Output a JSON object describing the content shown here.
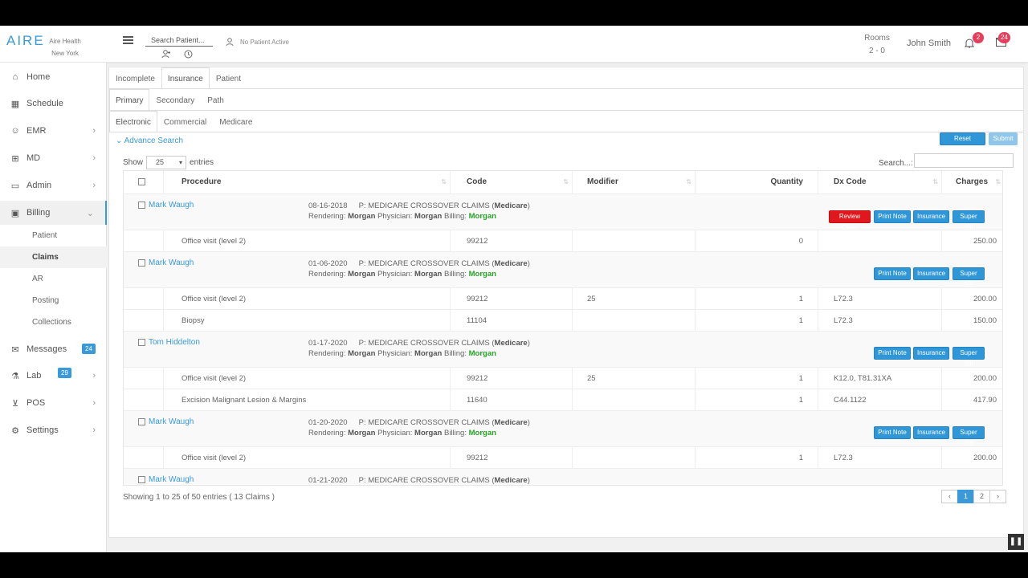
{
  "brand": {
    "logo": "AIRE",
    "org_line1": "Aire Health",
    "org_line2": "New York"
  },
  "topbar": {
    "search_placeholder": "Search Patient...",
    "patient_status": "No Patient Active",
    "rooms_label": "Rooms",
    "rooms_value": "2 - 0",
    "user": "John Smith",
    "notif_count": "2",
    "mail_count": "24"
  },
  "sidebar": {
    "items": [
      {
        "label": "Home",
        "icon": "home-icon"
      },
      {
        "label": "Schedule",
        "icon": "calendar-icon"
      },
      {
        "label": "EMR",
        "icon": "user-icon"
      },
      {
        "label": "MD",
        "icon": "medkit-icon"
      },
      {
        "label": "Admin",
        "icon": "monitor-icon"
      },
      {
        "label": "Billing",
        "icon": "money-icon"
      },
      {
        "label": "Messages",
        "icon": "envelope-icon",
        "badge": "24"
      },
      {
        "label": "Lab",
        "icon": "lab-icon",
        "badge": "29"
      },
      {
        "label": "POS",
        "icon": "cart-icon"
      },
      {
        "label": "Settings",
        "icon": "gears-icon"
      }
    ],
    "billing_sub": [
      "Patient",
      "Claims",
      "AR",
      "Posting",
      "Collections"
    ]
  },
  "tabs1": [
    "Incomplete",
    "Insurance",
    "Patient"
  ],
  "tabs2": [
    "Primary",
    "Secondary",
    "Path"
  ],
  "tabs3": [
    "Electronic",
    "Commercial",
    "Medicare"
  ],
  "toolbar": {
    "advance_search": "Advance Search",
    "reset": "Reset Search",
    "submit": "Submit",
    "show": "Show",
    "entries_value": "25",
    "entries": "entries",
    "search_label": "Search...:"
  },
  "columns": [
    "Procedure",
    "Code",
    "Modifier",
    "Quantity",
    "Dx Code",
    "Charges"
  ],
  "labels": {
    "rendering": "Rendering:",
    "physician": "Physician:",
    "billing": "Billing:"
  },
  "buttons": {
    "review": "Review Claim",
    "print": "Print Note",
    "insurance": "Insurance",
    "superbill": "Super Bill"
  },
  "groups": [
    {
      "patient": "Mark Waugh",
      "date": "08-16-2018",
      "payer": "P: MEDICARE CROSSOVER CLAIMS (",
      "payer_bold": "Medicare",
      "rendering": "Morgan",
      "physician": "Morgan",
      "billing": "Morgan",
      "review": true,
      "lines": [
        {
          "procedure": "Office visit (level 2)",
          "code": "99212",
          "modifier": "",
          "qty": "0",
          "dx": "",
          "charge": "250.00"
        }
      ]
    },
    {
      "patient": "Mark Waugh",
      "date": "01-06-2020",
      "payer": "P: MEDICARE CROSSOVER CLAIMS (",
      "payer_bold": "Medicare",
      "rendering": "Morgan",
      "physician": "Morgan",
      "billing": "Morgan",
      "review": false,
      "lines": [
        {
          "procedure": "Office visit (level 2)",
          "code": "99212",
          "modifier": "25",
          "qty": "1",
          "dx": "L72.3",
          "charge": "200.00"
        },
        {
          "procedure": "Biopsy",
          "code": "11104",
          "modifier": "",
          "qty": "1",
          "dx": "L72.3",
          "charge": "150.00"
        }
      ]
    },
    {
      "patient": "Tom Hiddelton",
      "date": "01-17-2020",
      "payer": "P: MEDICARE CROSSOVER CLAIMS (",
      "payer_bold": "Medicare",
      "rendering": "Morgan",
      "physician": "Morgan",
      "billing": "Morgan",
      "review": false,
      "lines": [
        {
          "procedure": "Office visit (level 2)",
          "code": "99212",
          "modifier": "25",
          "qty": "1",
          "dx": "K12.0, T81.31XA",
          "charge": "200.00"
        },
        {
          "procedure": "Excision Malignant Lesion & Margins",
          "code": "11640",
          "modifier": "",
          "qty": "1",
          "dx": "C44.1122",
          "charge": "417.90"
        }
      ]
    },
    {
      "patient": "Mark Waugh",
      "date": "01-20-2020",
      "payer": "P: MEDICARE CROSSOVER CLAIMS (",
      "payer_bold": "Medicare",
      "rendering": "Morgan",
      "physician": "Morgan",
      "billing": "Morgan",
      "review": false,
      "lines": [
        {
          "procedure": "Office visit (level 2)",
          "code": "99212",
          "modifier": "",
          "qty": "1",
          "dx": "L72.3",
          "charge": "200.00"
        }
      ]
    },
    {
      "patient": "Mark Waugh",
      "date": "01-21-2020",
      "payer": "P: MEDICARE CROSSOVER CLAIMS (",
      "payer_bold": "Medicare",
      "rendering": "",
      "physician": "",
      "billing": "",
      "review": false,
      "partial": true,
      "lines": []
    }
  ],
  "footer": {
    "info": "Showing 1 to 25 of 50 entries ( 13 Claims )",
    "pages": [
      "‹",
      "1",
      "2",
      "›"
    ]
  },
  "colors": {
    "accent": "#3a9ad9",
    "danger": "#e0171c",
    "billing_green": "#28a528"
  }
}
